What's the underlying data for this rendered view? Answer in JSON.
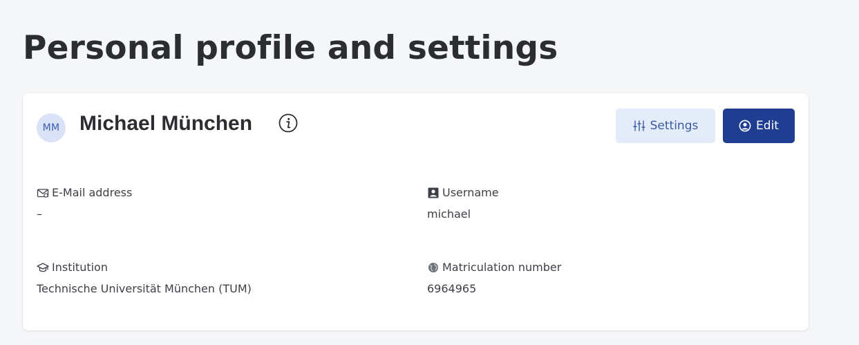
{
  "page": {
    "title": "Personal profile and settings"
  },
  "profile": {
    "initials": "MM",
    "name": "Michael München",
    "info_icon": "info-circle-icon"
  },
  "actions": {
    "settings_label": "Settings",
    "settings_icon": "sliders-icon",
    "edit_label": "Edit",
    "edit_icon": "user-circle-icon"
  },
  "fields": {
    "email": {
      "label": "E-Mail address",
      "value": "–",
      "icon": "envelope-icon"
    },
    "username": {
      "label": "Username",
      "value": "michael",
      "icon": "id-card-icon"
    },
    "institution": {
      "label": "Institution",
      "value": "Technische Universität München (TUM)",
      "icon": "graduation-cap-icon"
    },
    "matriculation": {
      "label": "Matriculation number",
      "value": "6964965",
      "icon": "globe-icon"
    }
  },
  "colors": {
    "background": "#f5f6f8",
    "card": "#ffffff",
    "primary": "#1f3e91",
    "secondary_bg": "#e4ebf9",
    "secondary_text": "#3a5ba3",
    "avatar_bg": "#d9e2f7"
  }
}
